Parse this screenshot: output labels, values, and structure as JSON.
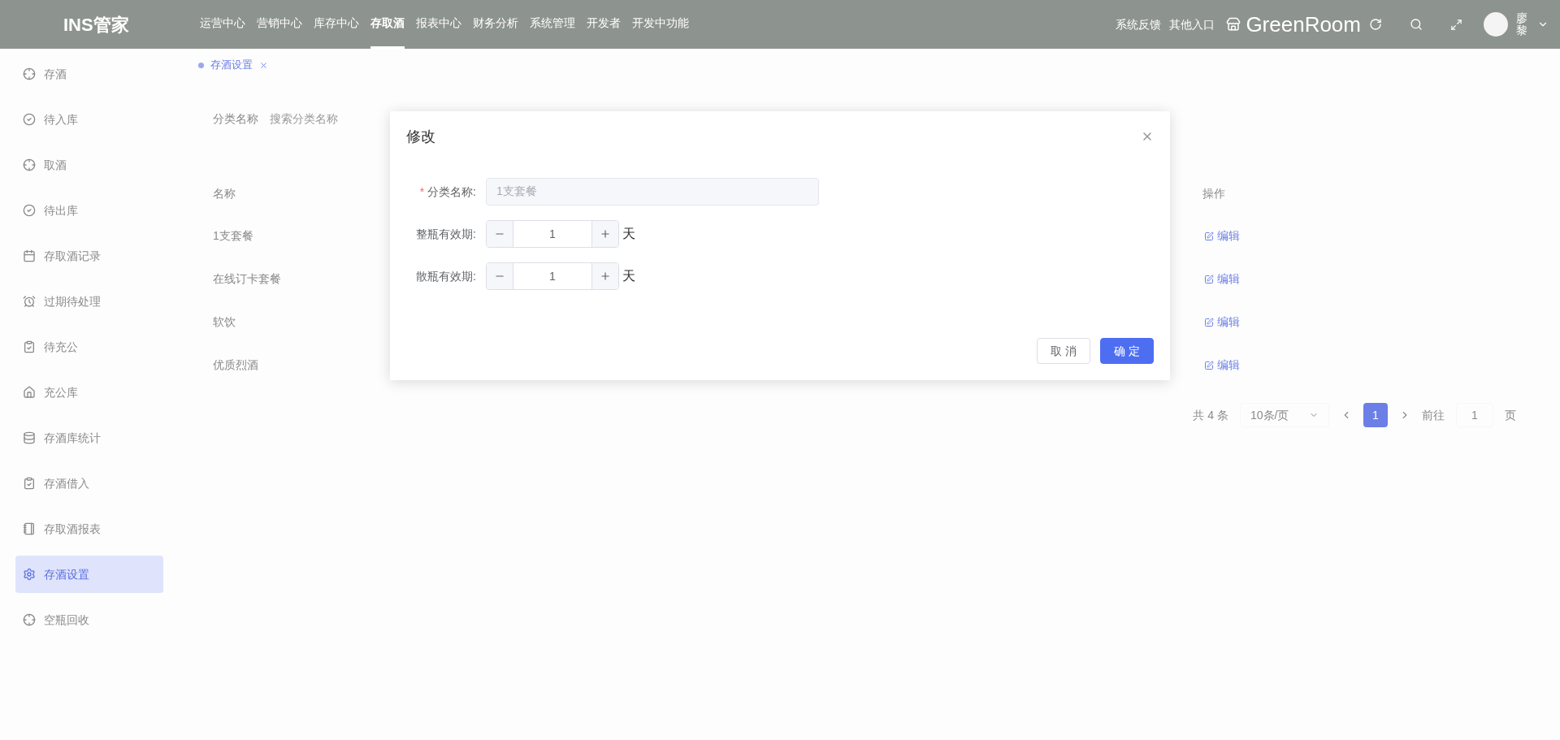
{
  "header": {
    "logo": "INS管家",
    "nav": [
      {
        "label": "运营中心",
        "selected": false
      },
      {
        "label": "营销中心",
        "selected": false
      },
      {
        "label": "库存中心",
        "selected": false
      },
      {
        "label": "存取酒",
        "selected": true
      },
      {
        "label": "报表中心",
        "selected": false
      },
      {
        "label": "财务分析",
        "selected": false
      },
      {
        "label": "系统管理",
        "selected": false
      },
      {
        "label": "开发者",
        "selected": false
      },
      {
        "label": "开发中功能",
        "selected": false
      }
    ],
    "links": [
      "系统反馈",
      "其他入口"
    ],
    "store": "GreenRoom",
    "user": "廖黎"
  },
  "sidebar": {
    "items": [
      {
        "label": "存酒",
        "selected": false
      },
      {
        "label": "待入库",
        "selected": false
      },
      {
        "label": "取酒",
        "selected": false
      },
      {
        "label": "待出库",
        "selected": false
      },
      {
        "label": "存取酒记录",
        "selected": false
      },
      {
        "label": "过期待处理",
        "selected": false
      },
      {
        "label": "待充公",
        "selected": false
      },
      {
        "label": "充公库",
        "selected": false
      },
      {
        "label": "存酒库统计",
        "selected": false
      },
      {
        "label": "存酒借入",
        "selected": false
      },
      {
        "label": "存取酒报表",
        "selected": false
      },
      {
        "label": "存酒设置",
        "selected": true
      },
      {
        "label": "空瓶回收",
        "selected": false
      }
    ]
  },
  "page_tab": {
    "label": "存酒设置"
  },
  "filter": {
    "label": "分类名称",
    "placeholder": "搜索分类名称"
  },
  "table": {
    "columns": [
      "名称",
      "操作"
    ],
    "rows": [
      {
        "name": "1支套餐",
        "action": "编辑"
      },
      {
        "name": "在线订卡套餐",
        "action": "编辑"
      },
      {
        "name": "软饮",
        "action": "编辑"
      },
      {
        "name": "优质烈酒",
        "action": "编辑"
      }
    ]
  },
  "pagination": {
    "total": "共 4 条",
    "page_size": "10条/页",
    "pages": [
      {
        "label": "1",
        "selected": true
      }
    ],
    "goto": "前往",
    "goto_value": "1",
    "goto_unit": "页"
  },
  "dialog": {
    "title": "修改",
    "fields": [
      {
        "kind": "text",
        "required_mark": "*",
        "label": "分类名称:",
        "value": "1支套餐",
        "disabled": true
      },
      {
        "kind": "number",
        "label": "整瓶有效期:",
        "value": "1",
        "unit": "天"
      },
      {
        "kind": "number",
        "label": "散瓶有效期:",
        "value": "1",
        "unit": "天"
      }
    ],
    "buttons": [
      {
        "label": "取 消",
        "kind": "secondary"
      },
      {
        "label": "确 定",
        "kind": "primary"
      }
    ]
  }
}
